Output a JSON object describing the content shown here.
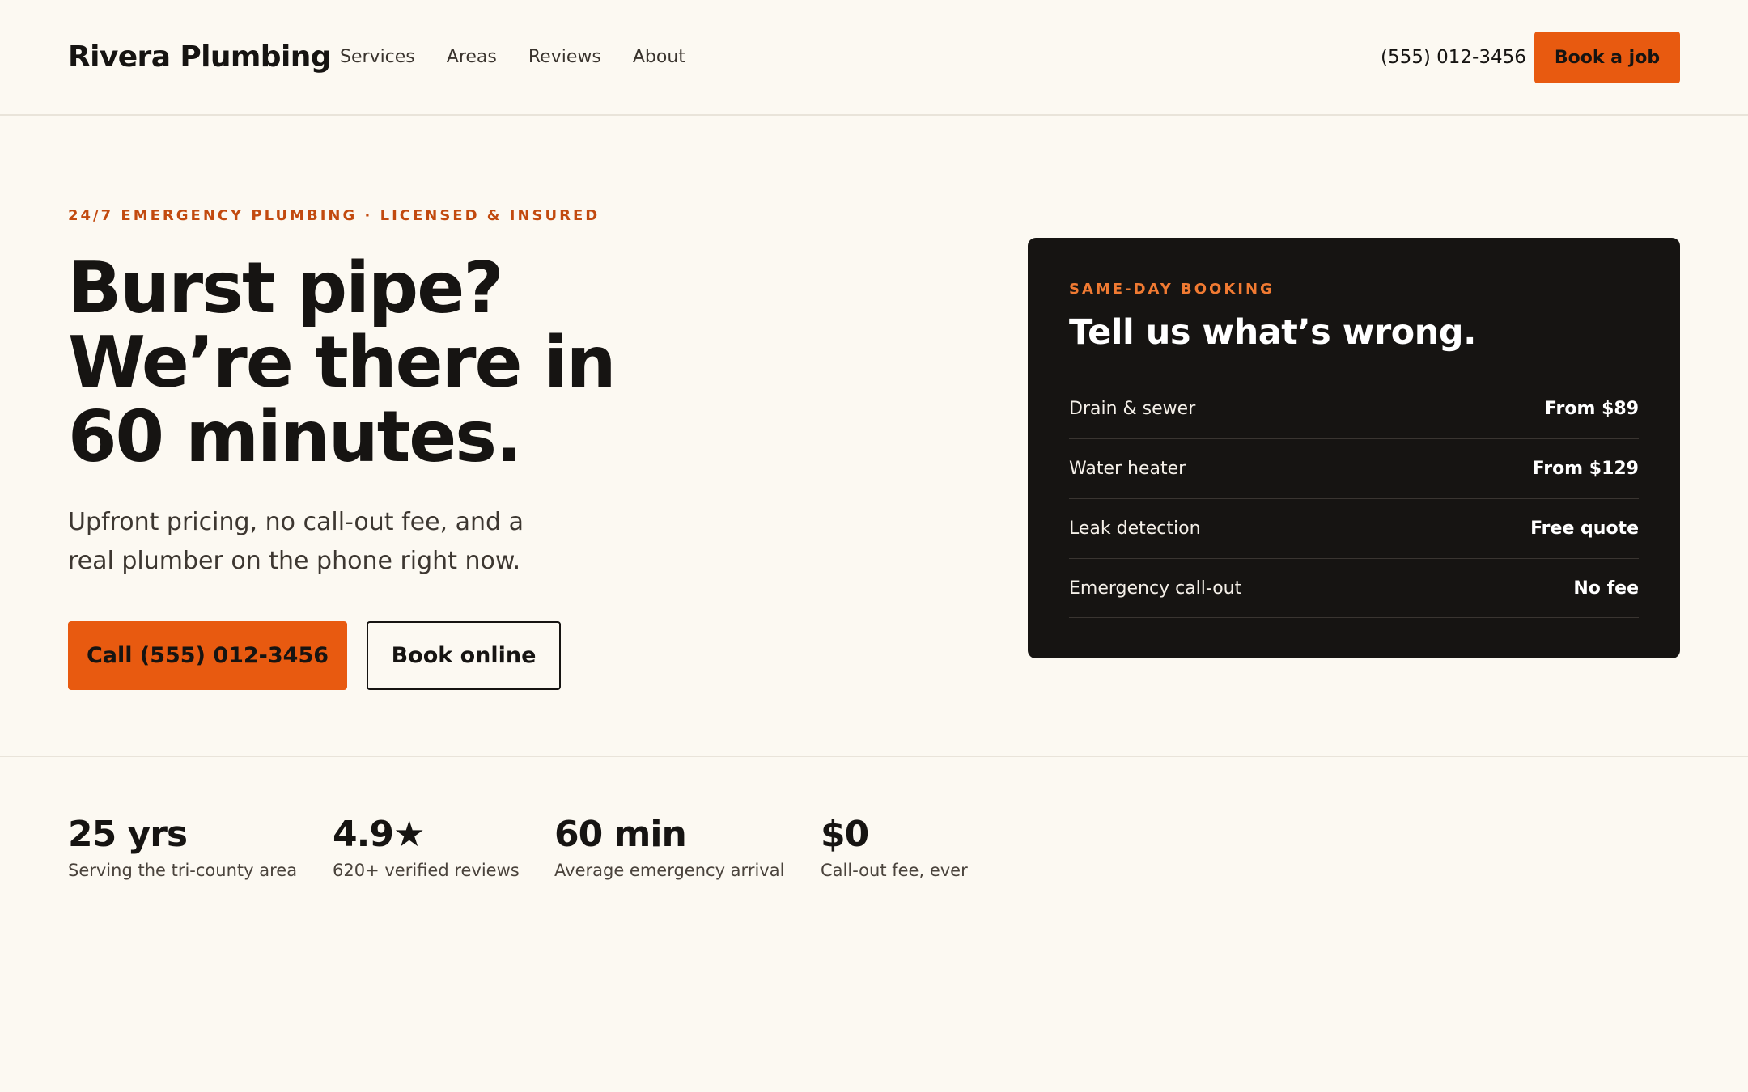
{
  "header": {
    "logo": "Rivera Plumbing",
    "nav": [
      "Services",
      "Areas",
      "Reviews",
      "About"
    ],
    "phone": "(555) 012-3456",
    "book_label": "Book a job"
  },
  "hero": {
    "eyebrow": "24/7 EMERGENCY PLUMBING · LICENSED & INSURED",
    "headline": [
      "Burst pipe?",
      "We’re there in",
      "60 minutes."
    ],
    "subhead": "Upfront pricing, no call-out fee, and a real plumber on the phone right now.",
    "call_label": "Call (555) 012-3456",
    "book_label": "Book online"
  },
  "booking_card": {
    "eyebrow": "SAME-DAY BOOKING",
    "title": "Tell us what’s wrong.",
    "services": [
      {
        "name": "Drain & sewer",
        "price": "From $89"
      },
      {
        "name": "Water heater",
        "price": "From $129"
      },
      {
        "name": "Leak detection",
        "price": "Free quote"
      },
      {
        "name": "Emergency call-out",
        "price": "No fee"
      }
    ]
  },
  "stats": [
    {
      "value": "25 yrs",
      "label": "Serving the tri-county area"
    },
    {
      "value": "4.9★",
      "label": "620+ verified reviews"
    },
    {
      "value": "60 min",
      "label": "Average emergency arrival"
    },
    {
      "value": "$0",
      "label": "Call-out fee, ever"
    }
  ],
  "colors": {
    "background": "#fcf9f2",
    "accent": "#e85a10",
    "eyebrow": "#c24a0f",
    "card": "#161412",
    "text": "#161412"
  }
}
